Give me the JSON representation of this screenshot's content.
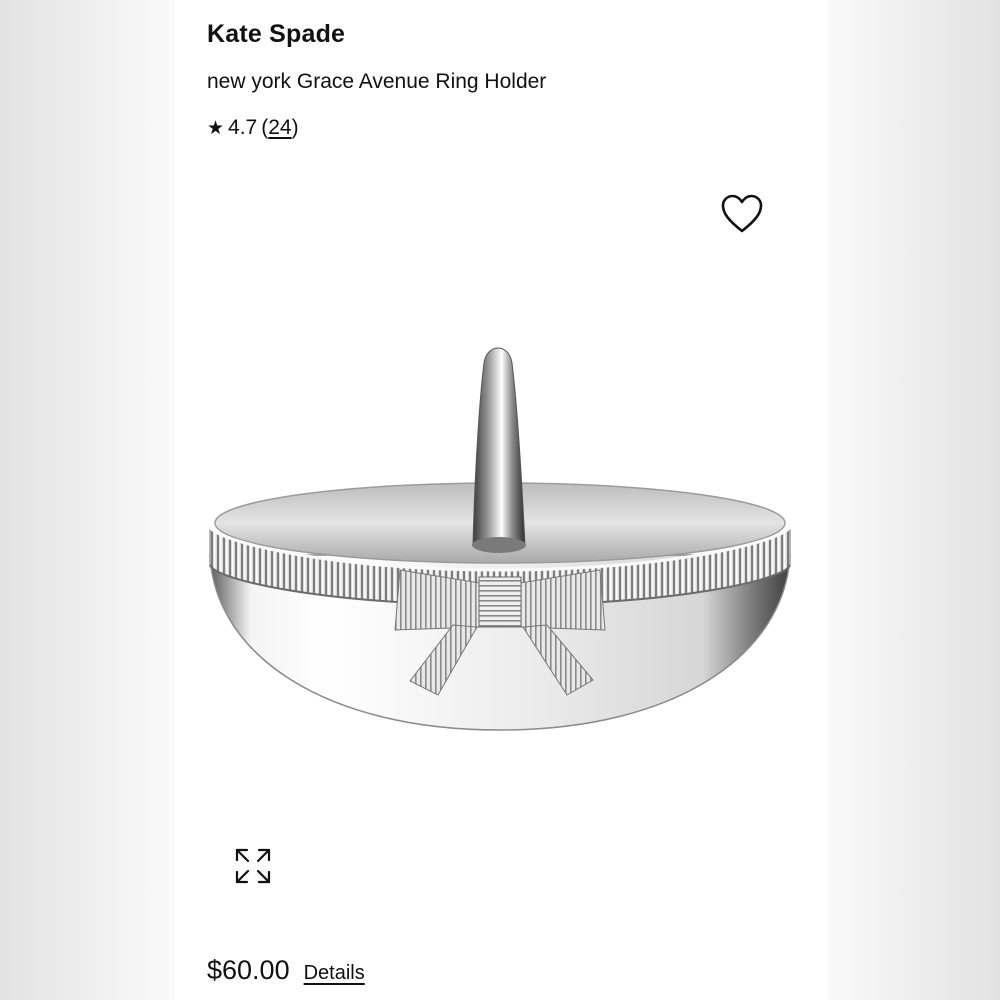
{
  "product": {
    "brand": "Kate Spade",
    "name": "new york Grace Avenue Ring Holder",
    "rating": {
      "star": "★",
      "value": "4.7",
      "open_paren": "(",
      "count": "24",
      "close_paren": ")"
    },
    "price": "$60.00",
    "details_label": "Details"
  },
  "icons": {
    "wishlist": "heart-outline-icon",
    "expand": "expand-arrows-icon"
  },
  "colors": {
    "text": "#111111",
    "background": "#ffffff"
  }
}
